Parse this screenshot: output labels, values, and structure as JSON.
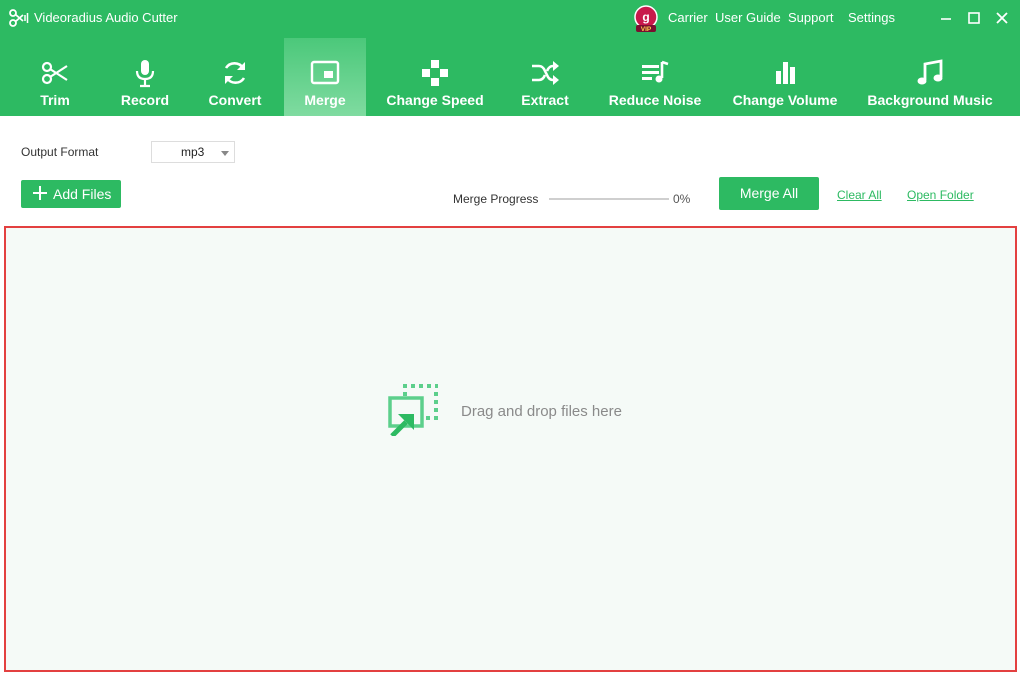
{
  "window": {
    "title": "Videoradius Audio Cutter",
    "top_links": [
      "Carrier",
      "User Guide",
      "Support",
      "Settings"
    ],
    "vip_label": "VIP",
    "vip_letter": "g",
    "controls": [
      "minimize-icon",
      "maximize-icon",
      "close-icon"
    ]
  },
  "toolbar": {
    "active": "Merge",
    "items": [
      {
        "label": "Trim",
        "icon": "scissors-icon"
      },
      {
        "label": "Record",
        "icon": "microphone-icon"
      },
      {
        "label": "Convert",
        "icon": "refresh-icon"
      },
      {
        "label": "Merge",
        "icon": "merge-icon"
      },
      {
        "label": "Change Speed",
        "icon": "gamepad-icon"
      },
      {
        "label": "Extract",
        "icon": "shuffle-icon"
      },
      {
        "label": "Reduce Noise",
        "icon": "playlist-icon"
      },
      {
        "label": "Change Volume",
        "icon": "bars-icon"
      },
      {
        "label": "Background Music",
        "icon": "music-note-icon"
      }
    ]
  },
  "controls": {
    "output_format_label": "Output Format",
    "output_format_value": "mp3",
    "add_files_label": "Add Files",
    "merge_progress_label": "Merge Progress",
    "merge_progress_percent": 0,
    "merge_progress_text": "0%",
    "merge_all_label": "Merge All",
    "clear_all_label": "Clear All",
    "open_folder_label": "Open Folder"
  },
  "dropzone": {
    "text": "Drag and drop files here",
    "icon": "drag-drop-icon"
  },
  "colors": {
    "accent": "#2dba62",
    "dropzone_border": "#e34040",
    "dropzone_bg": "#f5faf7"
  }
}
